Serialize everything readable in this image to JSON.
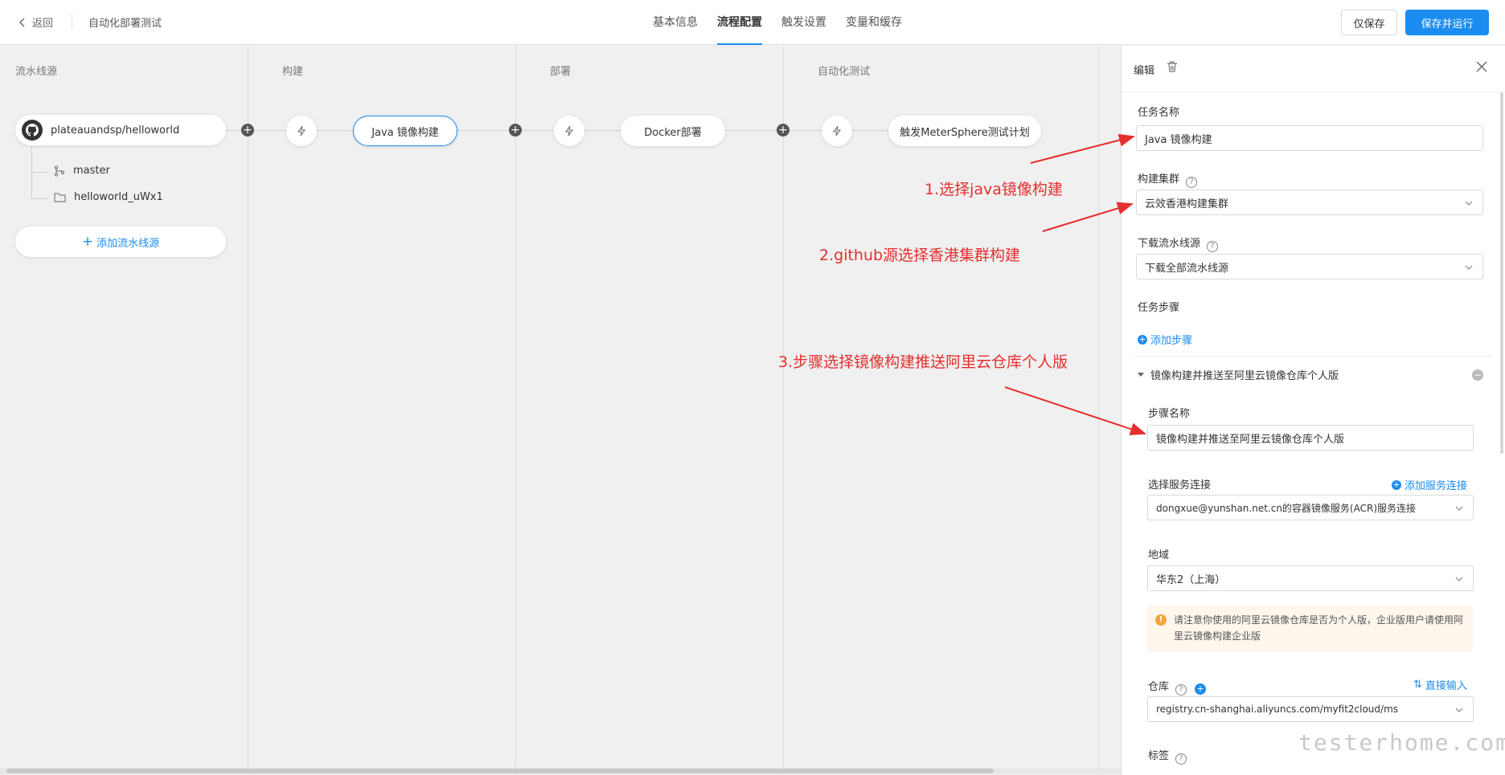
{
  "header": {
    "back_label": "返回",
    "page_title": "自动化部署测试",
    "tabs": [
      {
        "label": "基本信息",
        "active": false
      },
      {
        "label": "流程配置",
        "active": true
      },
      {
        "label": "触发设置",
        "active": false
      },
      {
        "label": "变量和缓存",
        "active": false
      }
    ],
    "save_only_label": "仅保存",
    "save_run_label": "保存并运行"
  },
  "pipeline": {
    "columns": [
      "流水线源",
      "构建",
      "部署",
      "自动化测试"
    ],
    "source": {
      "repo": "plateauandsp/helloworld",
      "branch": "master",
      "folder": "helloworld_uWx1",
      "add_label": "添加流水线源"
    },
    "tasks": [
      {
        "label": "Java 镜像构建",
        "selected": true
      },
      {
        "label": "Docker部署",
        "selected": false
      },
      {
        "label": "触发MeterSphere测试计划",
        "selected": false
      }
    ]
  },
  "panel": {
    "title": "编辑",
    "task_name_label": "任务名称",
    "task_name_value": "Java 镜像构建",
    "cluster_label": "构建集群",
    "cluster_value": "云效香港构建集群",
    "download_label": "下载流水线源",
    "download_value": "下载全部流水线源",
    "steps_label": "任务步骤",
    "add_step_label": "添加步骤",
    "step_title": "镜像构建并推送至阿里云镜像仓库个人版",
    "step_name_label": "步骤名称",
    "step_name_value": "镜像构建并推送至阿里云镜像仓库个人版",
    "service_label": "选择服务连接",
    "add_service_label": "添加服务连接",
    "service_value": "dongxue@yunshan.net.cn的容器镜像服务(ACR)服务连接",
    "region_label": "地域",
    "region_value": "华东2（上海）",
    "warning_text": "请注意你使用的阿里云镜像仓库是否为个人版，企业版用户请使用阿里云镜像构建企业版",
    "repo_label": "仓库",
    "direct_input_label": "直接输入",
    "repo_value": "registry.cn-shanghai.aliyuncs.com/myfit2cloud/ms",
    "tag_label": "标签"
  },
  "annotations": [
    "1.选择java镜像构建",
    "2.github源选择香港集群构建",
    "3.步骤选择镜像构建推送阿里云仓库个人版"
  ],
  "watermark": "testerhome.com",
  "colors": {
    "accent": "#1b8cf0",
    "annotation": "#e52e2e",
    "warning_bg": "#fff6ed"
  }
}
